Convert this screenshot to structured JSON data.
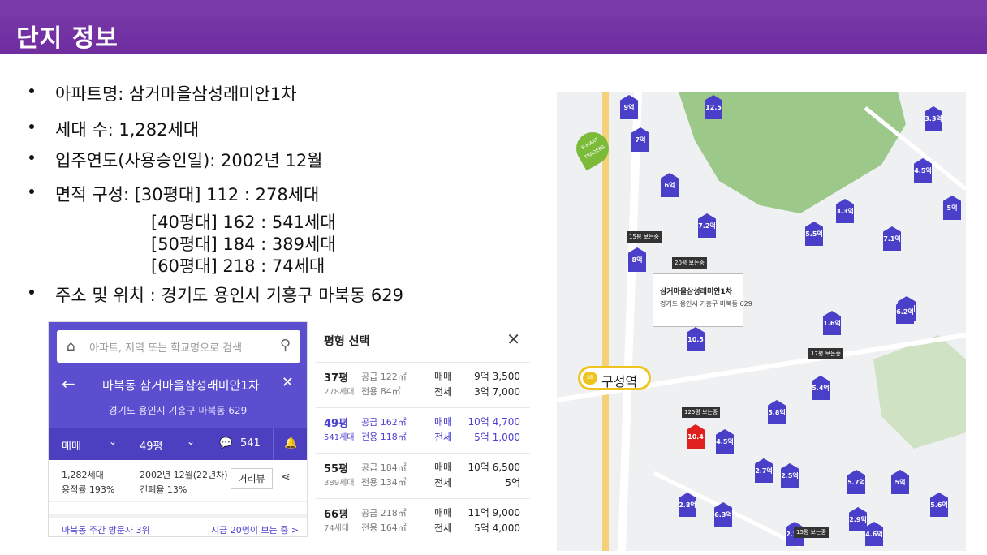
{
  "header": {
    "title": "단지 정보"
  },
  "info": {
    "apt_name": "아파트명: 삼거마을삼성래미안1차",
    "households": "세대 수: 1,282세대",
    "move_in": "입주연도(사용승인일): 2002년 12월",
    "area_head": "면적 구성: [30평대] 112 : 278세대",
    "area_rows": [
      "[40평대] 162 : 541세대",
      "[50평대] 184 : 389세대",
      "[60평대] 218 : 74세대"
    ],
    "address": "주소  및 위치 : 경기도 용인시 기흥구 마북동 629"
  },
  "app": {
    "search_placeholder": "아파트, 지역 또는 학교명으로 검색",
    "apt_title": "마북동 삼거마을삼성래미안1차",
    "apt_address": "경기도 용인시 기흥구 마북동 629",
    "filter_trade": "매매",
    "filter_size": "49평",
    "comment_count": "541",
    "hh_count": "1,282세대",
    "far": "용적률 193%",
    "built": "2002년 12월(22년차)",
    "bcr": "건폐율 13%",
    "street_view": "거리뷰",
    "visitor_rank": "마북동 주간 방문자 3위",
    "viewing_now": "지금 20명이 보는 중 >"
  },
  "pyeong": {
    "title": "평형 선택",
    "rows": [
      {
        "py": "37평",
        "supply": "공급 122㎡",
        "hh": "278세대",
        "exclusive": "전용 84㎡",
        "sale_label": "매매",
        "sale": "9억 3,500",
        "jeonse_label": "전세",
        "jeonse": "3억 7,000"
      },
      {
        "py": "49평",
        "supply": "공급 162㎡",
        "hh": "541세대",
        "exclusive": "전용 118㎡",
        "sale_label": "매매",
        "sale": "10억 4,700",
        "jeonse_label": "전세",
        "jeonse": "5억 1,000"
      },
      {
        "py": "55평",
        "supply": "공급 184㎡",
        "hh": "389세대",
        "exclusive": "전용 134㎡",
        "sale_label": "매매",
        "sale": "10억 6,500",
        "jeonse_label": "전세",
        "jeonse": "5억"
      },
      {
        "py": "66평",
        "supply": "공급 218㎡",
        "hh": "74세대",
        "exclusive": "전용 164㎡",
        "sale_label": "매매",
        "sale": "11억 9,000",
        "jeonse_label": "전세",
        "jeonse": "5억 4,000"
      }
    ]
  },
  "map": {
    "callout_title": "삼거마을삼성래미안1차",
    "callout_addr": "경기도 용인시 기흥구 마북동 629",
    "station": "구성역",
    "emart": "E-MART TRADERS",
    "markers": [
      "9억",
      "12.5억",
      "7억",
      "6억",
      "7.2억",
      "8억",
      "3.3억",
      "4.5억",
      "5억",
      "3.3억",
      "5.5억",
      "7.1억",
      "4.2억",
      "6.2억",
      "10.5억",
      "10.4억",
      "4.5억",
      "5.8억",
      "5.4억",
      "2.7억",
      "2.5억",
      "5.7억",
      "5억",
      "5.6억",
      "6.3억",
      "2.9억",
      "4.6억",
      "2.8억",
      "1.6억",
      "2.2억"
    ],
    "tags": [
      "15평 보는중",
      "20평 보는중",
      "17평 보는중",
      "125평 보는중",
      "15평 보는중"
    ],
    "colors": {
      "marker": "#4a3fc9",
      "selected": "#e0201e",
      "header": "#6f2da0"
    }
  }
}
